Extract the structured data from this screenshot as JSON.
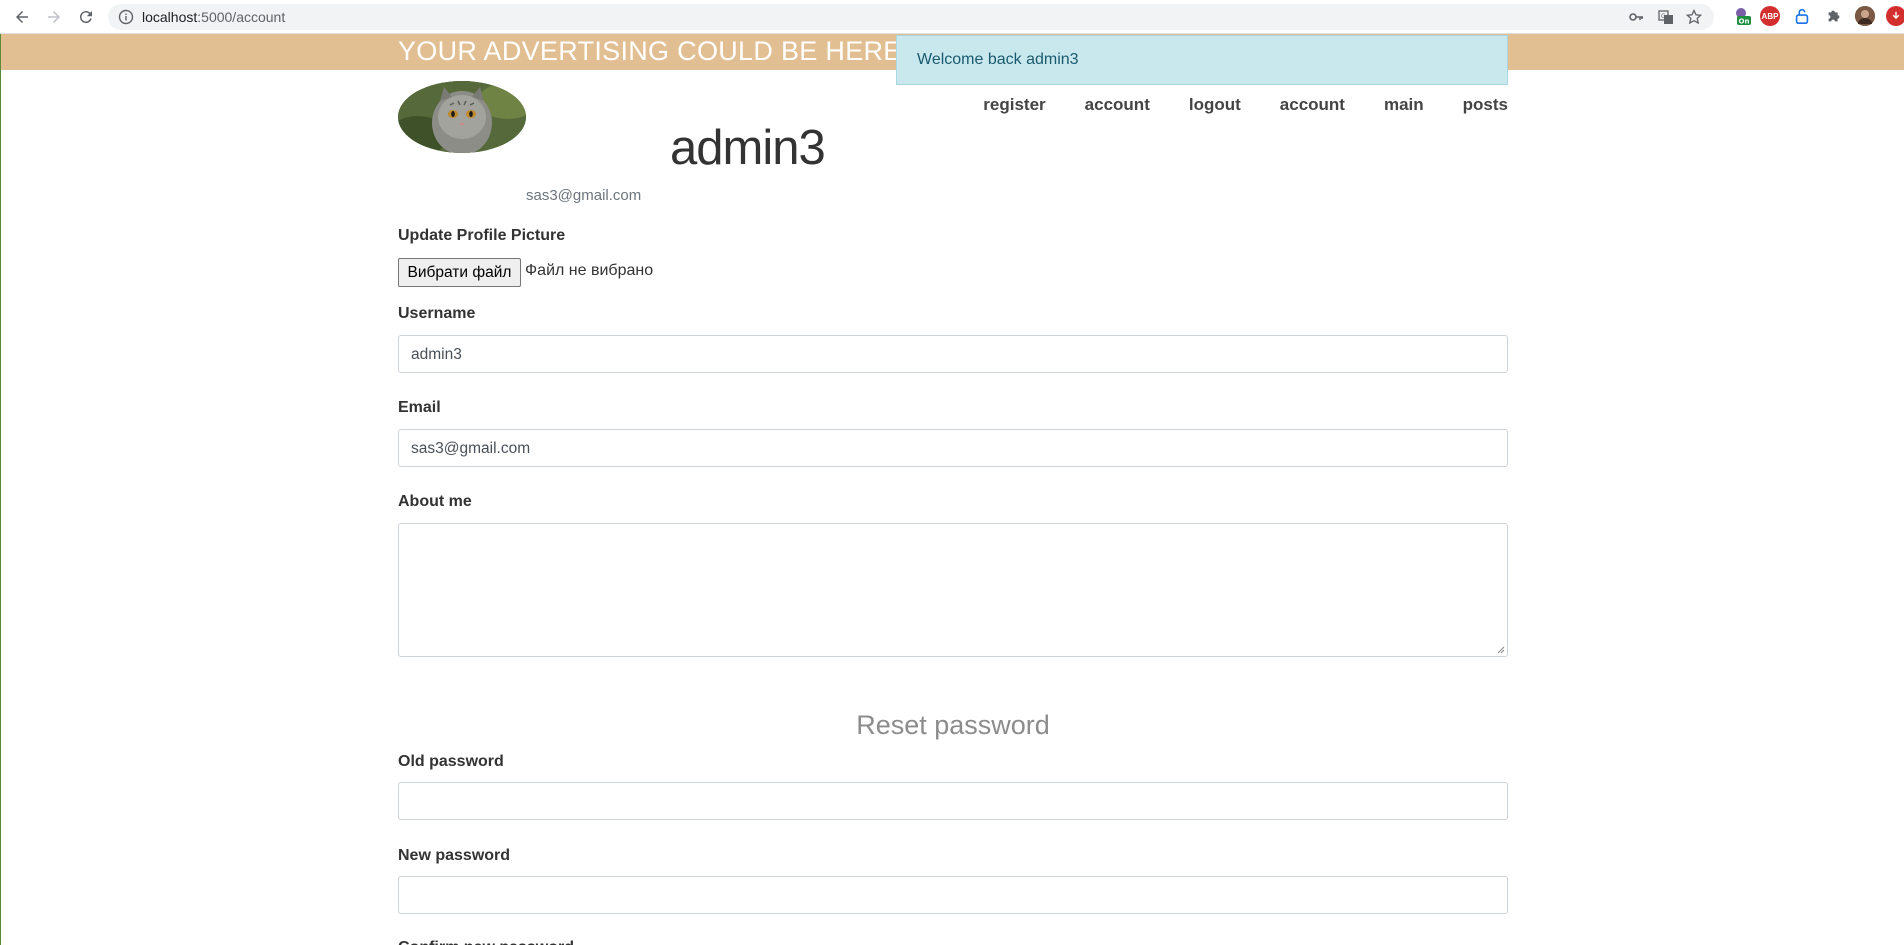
{
  "browser": {
    "url_host": "localhost",
    "url_rest": ":5000/account",
    "extensions": [
      "key-icon",
      "translate-icon",
      "star-icon",
      "on-extension-icon",
      "abp-extension-icon",
      "lock-extension-icon",
      "puzzle-icon",
      "profile-avatar-icon"
    ],
    "ext_on_label": "On",
    "ext_abp_label": "ABP"
  },
  "ad": {
    "text": "YOUR ADVERTISING COULD BE HERE"
  },
  "flash": {
    "message": "Welcome back admin3"
  },
  "nav": {
    "items": [
      "register",
      "account",
      "logout",
      "account",
      "main",
      "posts"
    ]
  },
  "profile": {
    "username": "admin3",
    "email": "sas3@gmail.com"
  },
  "form": {
    "picture_label": "Update Profile Picture",
    "file_button": "Вибрати файл",
    "file_status": "Файл не вибрано",
    "username_label": "Username",
    "username_value": "admin3",
    "email_label": "Email",
    "email_value": "sas3@gmail.com",
    "about_label": "About me",
    "about_value": "",
    "reset_title": "Reset password",
    "old_password_label": "Old password",
    "old_password_value": "",
    "new_password_label": "New password",
    "new_password_value": "",
    "confirm_password_label": "Confirm new password"
  },
  "colors": {
    "ad_banner": "#e2bf93",
    "alert_bg": "#c9e8ee",
    "alert_text": "#1a5a6e"
  }
}
